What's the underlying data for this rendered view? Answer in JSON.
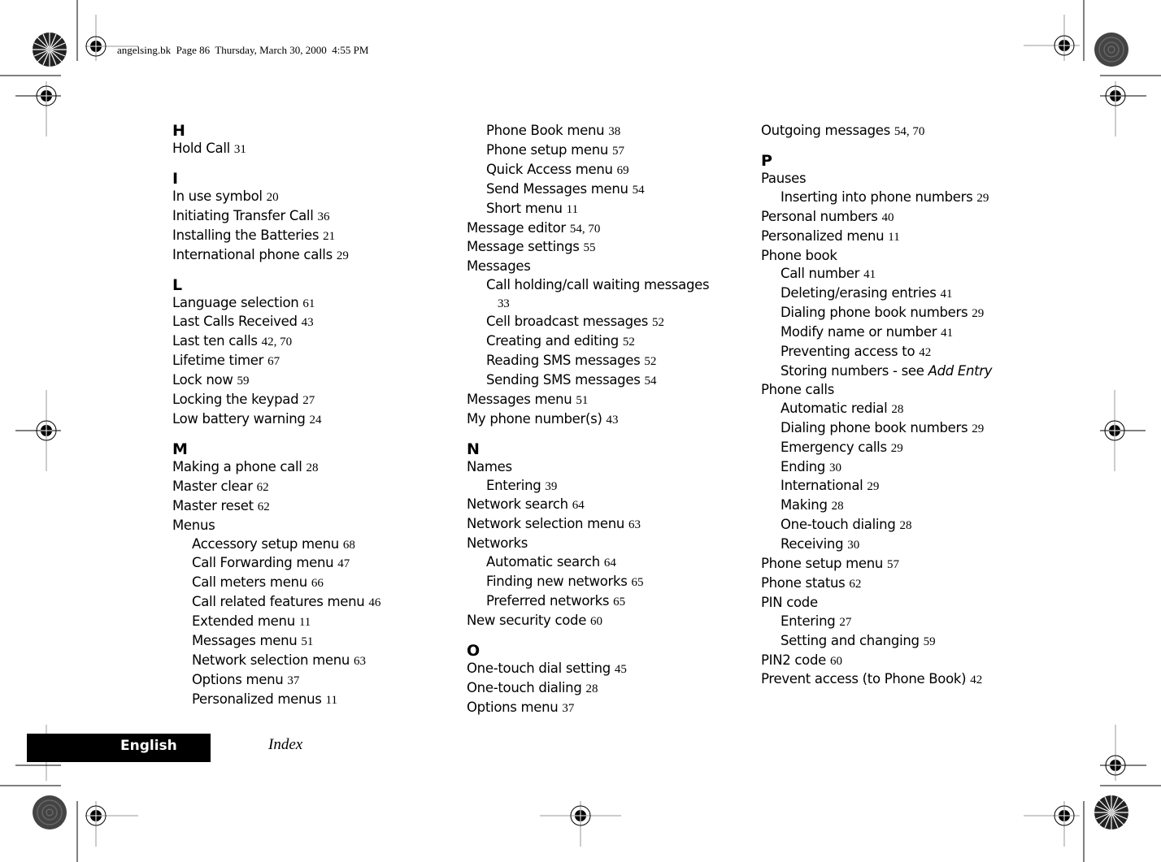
{
  "header": {
    "slug": "angelsing.bk  Page 86  Thursday, March 30, 2000  4:55 PM"
  },
  "footer": {
    "language_tab": "English",
    "section_title": "Index"
  },
  "index": {
    "col1": [
      {
        "type": "letter",
        "text": "H"
      },
      {
        "type": "entry",
        "text": "Hold Call",
        "pages": "31"
      },
      {
        "type": "letter",
        "text": "I"
      },
      {
        "type": "entry",
        "text": "In use symbol",
        "pages": "20"
      },
      {
        "type": "entry",
        "text": "Initiating Transfer Call",
        "pages": "36"
      },
      {
        "type": "entry",
        "text": "Installing the Batteries",
        "pages": "21"
      },
      {
        "type": "entry",
        "text": "International phone calls",
        "pages": "29"
      },
      {
        "type": "letter",
        "text": "L"
      },
      {
        "type": "entry",
        "text": "Language selection",
        "pages": "61"
      },
      {
        "type": "entry",
        "text": "Last Calls Received",
        "pages": "43"
      },
      {
        "type": "entry",
        "text": "Last ten calls",
        "pages": "42, 70"
      },
      {
        "type": "entry",
        "text": "Lifetime timer",
        "pages": "67"
      },
      {
        "type": "entry",
        "text": "Lock now",
        "pages": "59"
      },
      {
        "type": "entry",
        "text": "Locking the keypad",
        "pages": "27"
      },
      {
        "type": "entry",
        "text": "Low battery warning",
        "pages": "24"
      },
      {
        "type": "letter",
        "text": "M"
      },
      {
        "type": "entry",
        "text": "Making a phone call",
        "pages": "28"
      },
      {
        "type": "entry",
        "text": "Master clear",
        "pages": "62"
      },
      {
        "type": "entry",
        "text": "Master reset",
        "pages": "62"
      },
      {
        "type": "entry",
        "text": "Menus",
        "pages": ""
      },
      {
        "type": "sub",
        "text": "Accessory setup menu",
        "pages": "68"
      },
      {
        "type": "sub",
        "text": "Call Forwarding menu",
        "pages": "47"
      },
      {
        "type": "sub",
        "text": "Call meters menu",
        "pages": "66"
      },
      {
        "type": "sub",
        "text": "Call related features menu",
        "pages": "46"
      },
      {
        "type": "sub",
        "text": "Extended menu",
        "pages": "11"
      },
      {
        "type": "sub",
        "text": "Messages menu",
        "pages": "51"
      },
      {
        "type": "sub",
        "text": "Network selection menu",
        "pages": "63"
      },
      {
        "type": "sub",
        "text": "Options menu",
        "pages": "37"
      },
      {
        "type": "sub",
        "text": "Personalized menus",
        "pages": "11"
      }
    ],
    "col2": [
      {
        "type": "sub",
        "text": "Phone Book menu",
        "pages": "38"
      },
      {
        "type": "sub",
        "text": "Phone setup menu",
        "pages": "57"
      },
      {
        "type": "sub",
        "text": "Quick Access menu",
        "pages": "69"
      },
      {
        "type": "sub",
        "text": "Send Messages menu",
        "pages": "54"
      },
      {
        "type": "sub",
        "text": "Short menu",
        "pages": "11"
      },
      {
        "type": "entry",
        "text": "Message editor",
        "pages": "54, 70"
      },
      {
        "type": "entry",
        "text": "Message settings",
        "pages": "55"
      },
      {
        "type": "entry",
        "text": "Messages",
        "pages": ""
      },
      {
        "type": "subwrap",
        "text": "Call holding/call waiting messages",
        "pages": "33"
      },
      {
        "type": "sub",
        "text": "Cell broadcast messages",
        "pages": "52"
      },
      {
        "type": "sub",
        "text": "Creating and editing",
        "pages": "52"
      },
      {
        "type": "sub",
        "text": "Reading SMS messages",
        "pages": "52"
      },
      {
        "type": "sub",
        "text": "Sending SMS messages",
        "pages": "54"
      },
      {
        "type": "entry",
        "text": "Messages menu",
        "pages": "51"
      },
      {
        "type": "entry",
        "text": "My phone number(s)",
        "pages": "43"
      },
      {
        "type": "letter",
        "text": "N"
      },
      {
        "type": "entry",
        "text": "Names",
        "pages": ""
      },
      {
        "type": "sub",
        "text": "Entering",
        "pages": "39"
      },
      {
        "type": "entry",
        "text": "Network search",
        "pages": "64"
      },
      {
        "type": "entry",
        "text": "Network selection menu",
        "pages": "63"
      },
      {
        "type": "entry",
        "text": "Networks",
        "pages": ""
      },
      {
        "type": "sub",
        "text": "Automatic search",
        "pages": "64"
      },
      {
        "type": "sub",
        "text": "Finding new networks",
        "pages": "65"
      },
      {
        "type": "sub",
        "text": "Preferred networks",
        "pages": "65"
      },
      {
        "type": "entry",
        "text": "New security code",
        "pages": "60"
      },
      {
        "type": "letter",
        "text": "O"
      },
      {
        "type": "entry",
        "text": "One-touch dial setting",
        "pages": "45"
      },
      {
        "type": "entry",
        "text": "One-touch dialing",
        "pages": "28"
      },
      {
        "type": "entry",
        "text": "Options menu",
        "pages": "37"
      }
    ],
    "col3": [
      {
        "type": "entry",
        "text": "Outgoing messages",
        "pages": "54, 70"
      },
      {
        "type": "letter",
        "text": "P"
      },
      {
        "type": "entry",
        "text": "Pauses",
        "pages": ""
      },
      {
        "type": "sub",
        "text": "Inserting into phone numbers",
        "pages": "29"
      },
      {
        "type": "entry",
        "text": "Personal numbers",
        "pages": "40"
      },
      {
        "type": "entry",
        "text": "Personalized menu",
        "pages": "11"
      },
      {
        "type": "entry",
        "text": "Phone book",
        "pages": ""
      },
      {
        "type": "sub",
        "text": "Call number",
        "pages": "41"
      },
      {
        "type": "sub",
        "text": "Deleting/erasing entries",
        "pages": "41"
      },
      {
        "type": "sub",
        "text": "Dialing phone book numbers",
        "pages": "29"
      },
      {
        "type": "sub",
        "text": "Modify name or number",
        "pages": "41"
      },
      {
        "type": "sub",
        "text": "Preventing access to",
        "pages": "42"
      },
      {
        "type": "sub",
        "text": "Storing numbers - see",
        "pages": "",
        "see": "Add Entry"
      },
      {
        "type": "entry",
        "text": "Phone calls",
        "pages": ""
      },
      {
        "type": "sub",
        "text": "Automatic redial",
        "pages": "28"
      },
      {
        "type": "sub",
        "text": "Dialing phone book numbers",
        "pages": "29"
      },
      {
        "type": "sub",
        "text": "Emergency calls",
        "pages": "29"
      },
      {
        "type": "sub",
        "text": "Ending",
        "pages": "30"
      },
      {
        "type": "sub",
        "text": "International",
        "pages": "29"
      },
      {
        "type": "sub",
        "text": "Making",
        "pages": "28"
      },
      {
        "type": "sub",
        "text": "One-touch dialing",
        "pages": "28"
      },
      {
        "type": "sub",
        "text": "Receiving",
        "pages": "30"
      },
      {
        "type": "entry",
        "text": "Phone setup menu",
        "pages": "57"
      },
      {
        "type": "entry",
        "text": "Phone status",
        "pages": "62"
      },
      {
        "type": "entry",
        "text": "PIN code",
        "pages": ""
      },
      {
        "type": "sub",
        "text": "Entering",
        "pages": "27"
      },
      {
        "type": "sub",
        "text": "Setting and changing",
        "pages": "59"
      },
      {
        "type": "entry",
        "text": "PIN2 code",
        "pages": "60"
      },
      {
        "type": "entry",
        "text": "Prevent access (to Phone Book)",
        "pages": "42"
      }
    ]
  },
  "marks": {
    "registration_marks": "crosshair-target",
    "color_bars": "starburst-and-gray-disc"
  }
}
